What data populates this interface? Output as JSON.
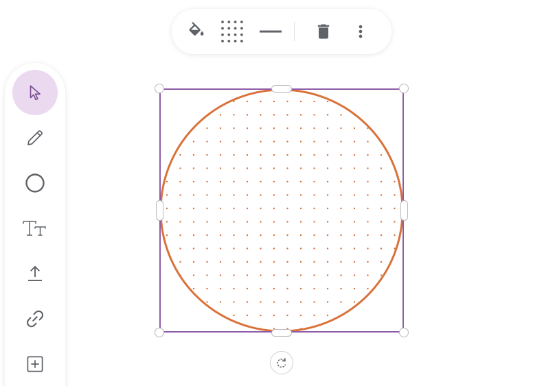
{
  "toolbar": {
    "items": [
      {
        "id": "fill",
        "icon": "paint-bucket-icon"
      },
      {
        "id": "pattern",
        "icon": "dot-grid-icon"
      },
      {
        "id": "stroke",
        "icon": "line-style-icon"
      },
      {
        "id": "delete",
        "icon": "trash-icon"
      },
      {
        "id": "more",
        "icon": "more-vertical-icon"
      }
    ]
  },
  "tools": [
    {
      "id": "select",
      "icon": "cursor-arrow-icon",
      "active": true
    },
    {
      "id": "draw",
      "icon": "pencil-icon",
      "active": false
    },
    {
      "id": "shape",
      "icon": "circle-icon",
      "active": false
    },
    {
      "id": "text",
      "icon": "text-icon",
      "active": false
    },
    {
      "id": "upload",
      "icon": "upload-icon",
      "active": false
    },
    {
      "id": "link",
      "icon": "link-icon",
      "active": false
    },
    {
      "id": "add",
      "icon": "add-box-icon",
      "active": false
    }
  ],
  "shape": {
    "type": "ellipse",
    "fill_pattern": "dots",
    "stroke_color": "#d9723a",
    "dot_color": "#d9723a",
    "selection_color": "#8e5ba8"
  },
  "colors": {
    "accent": "#8e5ba8",
    "active_tool_bg": "#ead9ef",
    "icon": "#5f6368"
  }
}
